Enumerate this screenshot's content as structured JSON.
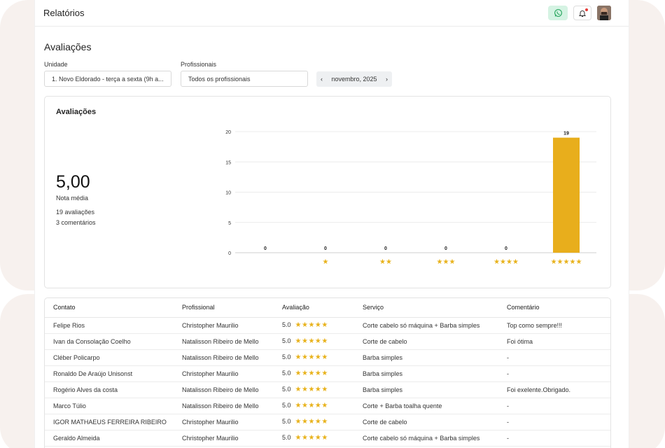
{
  "header": {
    "title": "Relatórios"
  },
  "page": {
    "title": "Avaliações"
  },
  "filters": {
    "unit_label": "Unidade",
    "unit_value": "1. Novo Eldorado - terça a sexta (9h a...",
    "professional_label": "Profissionais",
    "professional_value": "Todos os profissionais",
    "month_value": "novembro, 2025"
  },
  "summary": {
    "title": "Avaliações",
    "average": "5,00",
    "average_label": "Nota média",
    "reviews_count": "19 avaliações",
    "comments_count": "3 comentários"
  },
  "chart_data": {
    "type": "bar",
    "categories": [
      "",
      "★",
      "★★",
      "★★★",
      "★★★★",
      "★★★★★"
    ],
    "values": [
      0,
      0,
      0,
      0,
      0,
      19
    ],
    "ylim": [
      0,
      20
    ],
    "yticks": [
      0,
      5,
      10,
      15,
      20
    ],
    "bar_color": "#e8ae1c",
    "grid": true
  },
  "table": {
    "columns": [
      "Contato",
      "Profissional",
      "Avaliação",
      "Serviço",
      "Comentário"
    ],
    "rows": [
      {
        "contact": "Felipe Rios",
        "professional": "Christopher Maurilio",
        "rating": "5.0",
        "service": "Corte cabelo só máquina + Barba simples",
        "comment": "Top como sempre!!!"
      },
      {
        "contact": "Ivan da Consolação Coelho",
        "professional": "Natalisson Ribeiro de Mello",
        "rating": "5.0",
        "service": "Corte de cabelo",
        "comment": "Foi ótima"
      },
      {
        "contact": "Cléber Policarpo",
        "professional": "Natalisson Ribeiro de Mello",
        "rating": "5.0",
        "service": "Barba simples",
        "comment": "-"
      },
      {
        "contact": "Ronaldo De Araújo Unisonst",
        "professional": "Christopher Maurilio",
        "rating": "5.0",
        "service": "Barba simples",
        "comment": "-"
      },
      {
        "contact": "Rogério Alves da costa",
        "professional": "Natalisson Ribeiro de Mello",
        "rating": "5.0",
        "service": "Barba simples",
        "comment": "Foi exelente.Obrigado."
      },
      {
        "contact": "Marco Túlio",
        "professional": "Natalisson Ribeiro de Mello",
        "rating": "5.0",
        "service": "Corte + Barba toalha quente",
        "comment": "-"
      },
      {
        "contact": "IGOR MATHAEUS FERREIRA RIBEIRO",
        "professional": "Christopher Maurilio",
        "rating": "5.0",
        "service": "Corte de cabelo",
        "comment": "-"
      },
      {
        "contact": "Geraldo Almeida",
        "professional": "Christopher Maurilio",
        "rating": "5.0",
        "service": "Corte cabelo só máquina + Barba simples",
        "comment": "-"
      }
    ],
    "star_glyphs": "★★★★★"
  },
  "icons": {
    "whatsapp": "whatsapp-icon",
    "bell": "bell-icon",
    "prev": "chevron-left-icon",
    "next": "chevron-right-icon"
  },
  "colors": {
    "accent_green_bg": "#d5f3e3",
    "star": "#e8b21b"
  }
}
